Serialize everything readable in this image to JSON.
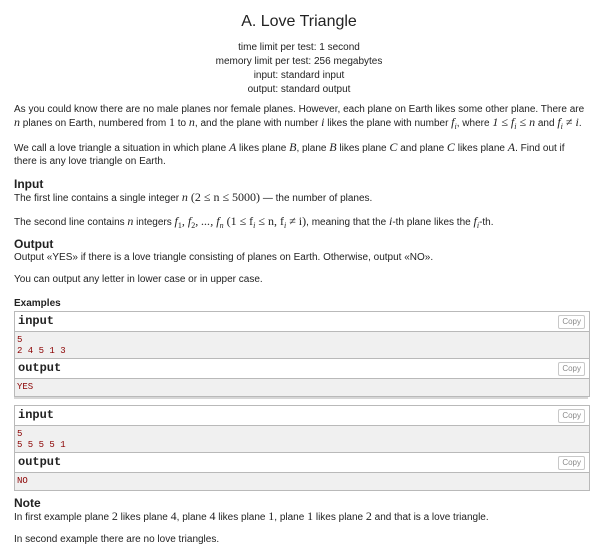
{
  "problem": {
    "title": "A. Love Triangle",
    "time_limit": "time limit per test: 1 second",
    "memory_limit": "memory limit per test: 256 megabytes",
    "input_file": "input: standard input",
    "output_file": "output: standard output"
  },
  "statement": {
    "p1_a": "As you could know there are no male planes nor female planes. However, each plane on Earth likes some other plane. There are ",
    "n": "n",
    "p1_b": " planes on Earth, numbered from ",
    "one": "1",
    "p1_c": " to ",
    "p1_d": ", and the plane with number ",
    "i": "i",
    "p1_e": " likes the plane with number ",
    "fi": "f",
    "fi_sub": "i",
    "p1_f": ", where ",
    "cond1": "1 ≤ f",
    "cond1_sub": "i",
    "cond1_tail": " ≤ n",
    "p1_g": " and ",
    "cond2": "f",
    "cond2_sub": "i",
    "cond2_tail": " ≠ i",
    "p1_h": ".",
    "p2_a": "We call a love triangle a situation in which plane ",
    "A": "A",
    "p2_b": " likes plane ",
    "B": "B",
    "p2_c": ", plane ",
    "p2_d": " likes plane ",
    "C": "C",
    "p2_e": " and plane ",
    "p2_f": " likes plane ",
    "p2_g": ". Find out if there is any love triangle on Earth."
  },
  "input_section": {
    "heading": "Input",
    "l1_a": "The first line contains a single integer ",
    "l1_n": "n",
    "l1_range": " (2 ≤ n ≤ 5000)",
    "l1_b": " — the number of planes.",
    "l2_a": "The second line contains ",
    "l2_n": "n",
    "l2_b": " integers ",
    "l2_seq": "f",
    "l2_seq_sub1": "1",
    "l2_seq_mid": ", f",
    "l2_seq_sub2": "2",
    "l2_seq_mid2": ", ..., f",
    "l2_seq_sub3": "n",
    "l2_range_a": " (1 ≤ f",
    "l2_range_sub": "i",
    "l2_range_b": " ≤ n, f",
    "l2_range_sub2": "i",
    "l2_range_c": " ≠ i)",
    "l2_c": ", meaning that the ",
    "l2_i": "i",
    "l2_d": "-th plane likes the ",
    "l2_f": "f",
    "l2_f_sub": "i",
    "l2_e": "-th."
  },
  "output_section": {
    "heading": "Output",
    "l1": "Output «YES» if there is a love triangle consisting of planes on Earth. Otherwise, output «NO».",
    "l2": "You can output any letter in lower case or in upper case."
  },
  "examples": {
    "heading": "Examples",
    "copy_label": "Copy",
    "items": [
      {
        "input_label": "input",
        "input": "5\n2 4 5 1 3",
        "output_label": "output",
        "output": "YES"
      },
      {
        "input_label": "input",
        "input": "5\n5 5 5 5 1",
        "output_label": "output",
        "output": "NO"
      }
    ]
  },
  "note": {
    "heading": "Note",
    "l1_a": "In first example plane ",
    "v2": "2",
    "l1_b": " likes plane ",
    "v4": "4",
    "l1_c": ", plane ",
    "l1_d": " likes plane ",
    "v1": "1",
    "l1_e": ", plane ",
    "l1_f": " likes plane ",
    "l1_g": " and that is a love triangle.",
    "l2": "In second example there are no love triangles."
  }
}
